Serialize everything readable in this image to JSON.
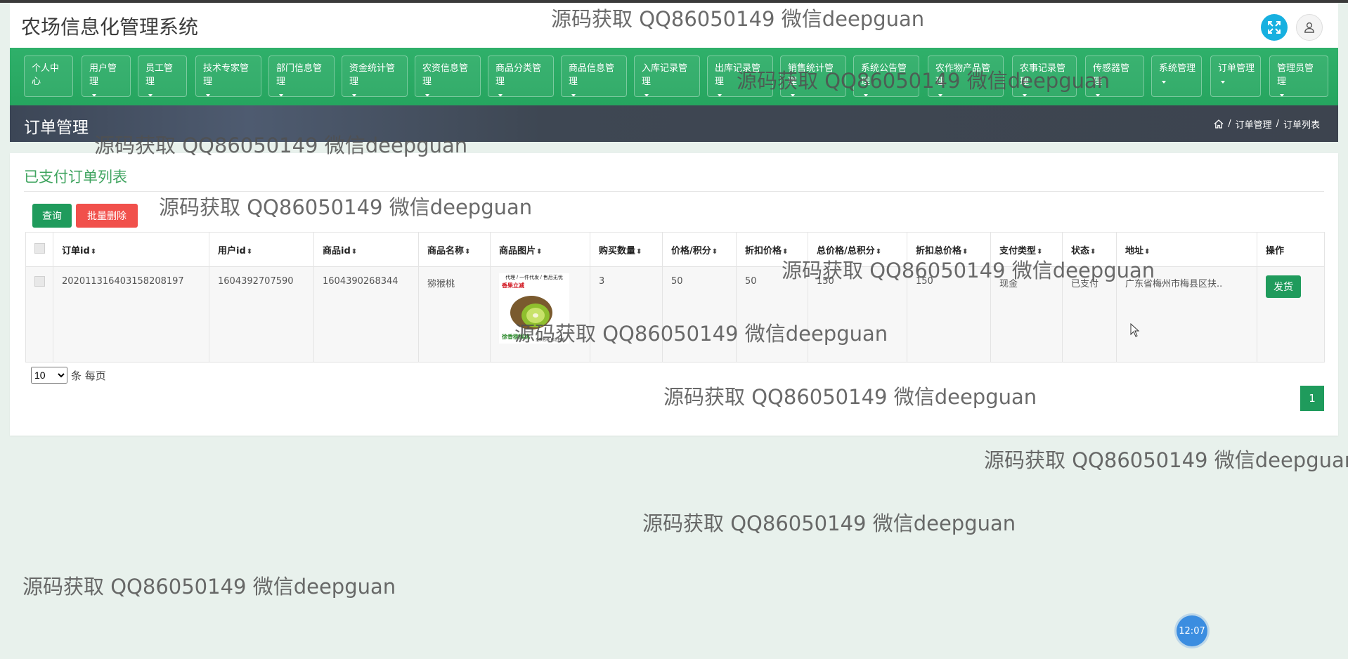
{
  "app": {
    "title": "农场信息化管理系统"
  },
  "nav": {
    "items": [
      {
        "label": "个人中心",
        "caret": false
      },
      {
        "label": "用户管理",
        "caret": true
      },
      {
        "label": "员工管理",
        "caret": true
      },
      {
        "label": "技术专家管理",
        "caret": true
      },
      {
        "label": "部门信息管理",
        "caret": true
      },
      {
        "label": "资金统计管理",
        "caret": true
      },
      {
        "label": "农资信息管理",
        "caret": true
      },
      {
        "label": "商品分类管理",
        "caret": true
      },
      {
        "label": "商品信息管理",
        "caret": true
      },
      {
        "label": "入库记录管理",
        "caret": true
      },
      {
        "label": "出库记录管理",
        "caret": true
      },
      {
        "label": "销售统计管理",
        "caret": true
      },
      {
        "label": "系统公告管理",
        "caret": true
      },
      {
        "label": "农作物产品管理",
        "caret": true
      },
      {
        "label": "农事记录管理",
        "caret": true
      },
      {
        "label": "传感器管理",
        "caret": true
      },
      {
        "label": "系统管理",
        "caret": true
      },
      {
        "label": "订单管理",
        "caret": true
      },
      {
        "label": "管理员管理",
        "caret": true
      }
    ]
  },
  "banner": {
    "title": "订单管理",
    "breadcrumb": [
      "订单管理",
      "订单列表"
    ],
    "separator": "/"
  },
  "card": {
    "title": "已支付订单列表",
    "query_label": "查询",
    "batch_delete_label": "批量删除"
  },
  "table": {
    "headers": [
      "订单id",
      "用户id",
      "商品id",
      "商品名称",
      "商品图片",
      "购买数量",
      "价格/积分",
      "折扣价格",
      "总价格/总积分",
      "折扣总价格",
      "支付类型",
      "状态",
      "地址",
      "操作"
    ],
    "sortable": [
      true,
      true,
      true,
      true,
      true,
      true,
      true,
      true,
      true,
      true,
      true,
      true,
      true,
      false
    ],
    "sort_glyph": "⬍",
    "rows": [
      {
        "order_id": "202011316403158208197",
        "user_id": "1604392707590",
        "product_id": "1604390268344",
        "product_name": "猕猴桃",
        "quantity": "3",
        "price": "50",
        "discount_price": "50",
        "total": "150",
        "discount_total": "150",
        "pay_type": "现金",
        "status": "已支付",
        "address": "广东省梅州市梅县区扶..",
        "action_label": "发货"
      }
    ]
  },
  "product_image_text": {
    "top": "代理 / 一件代发 / 售后无忧",
    "sub": "香果立减",
    "bottom": "徐香猕猴桃",
    "bottom2": "多款包装 可选包邮"
  },
  "pagination": {
    "page_size": "10",
    "page_size_options": [
      "10"
    ],
    "per_page_label": "条 每页",
    "current_page": "1"
  },
  "watermark": "源码获取 QQ86050149 微信deepguan",
  "clock": "12:07",
  "colors": {
    "primary_green": "#1f9b5c",
    "nav_green": "#2fb06a",
    "danger": "#f1504b",
    "title_green": "#3fa45f",
    "fullscreen_btn": "#17b0e0"
  }
}
